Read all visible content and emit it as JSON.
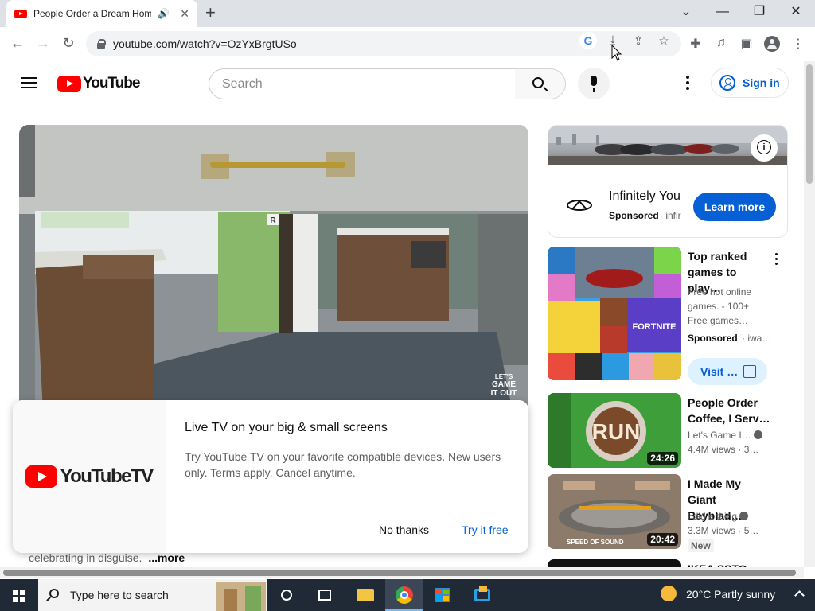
{
  "browser": {
    "tab_title": "People Order a Dream Hom",
    "new_tab_label": "+",
    "url": "youtube.com/watch?v=OzYxBrgtUSo",
    "window_controls": {
      "minimize": "—",
      "maximize": "❐",
      "close": "✕",
      "tab_search": "⌄"
    },
    "nav": {
      "back": "←",
      "forward": "→",
      "reload": "↻"
    },
    "google_icon_letter": "G"
  },
  "youtube": {
    "logo_text": "YouTube",
    "search_placeholder": "Search",
    "sign_in_label": "Sign in",
    "description_snippet": "celebrating in disguise.",
    "more_label": "...more",
    "video_overlay": {
      "channel_mark": "LET'S\nGAME\nIT OUT",
      "corner_label": "R"
    },
    "promo": {
      "logo_text": "YouTubeTV",
      "title": "Live TV on your big & small screens",
      "body": "Try YouTube TV on your favorite compatible devices. New users only. Terms apply. Cancel anytime.",
      "no_thanks": "No thanks",
      "try_free": "Try it free"
    },
    "ad": {
      "title": "Infinitely You",
      "sponsored": "Sponsored",
      "domain": "· infir",
      "cta": "Learn more"
    },
    "recommendations": [
      {
        "title": "Top ranked games to play…",
        "line1": "Free hot online games. - 100+ Free games…",
        "sponsored": "Sponsored",
        "domain": "· iwa…",
        "cta": "Visit …"
      },
      {
        "title": "People Order Coffee, I Serv…",
        "channel": "Let's Game I…",
        "views": "4.4M views",
        "age": "· 3…",
        "duration": "24:26",
        "thumb_text": "RUN"
      },
      {
        "title": "I Made My Giant Beyblad…",
        "channel": "I did a thing",
        "views": "3.3M views",
        "age": "· 5…",
        "duration": "20:42",
        "badge": "New",
        "thumb_text": "SPEED OF SOUND"
      },
      {
        "title": "IKEA SSTO"
      }
    ]
  },
  "taskbar": {
    "search_placeholder": "Type here to search",
    "weather": "20°C  Partly sunny"
  }
}
